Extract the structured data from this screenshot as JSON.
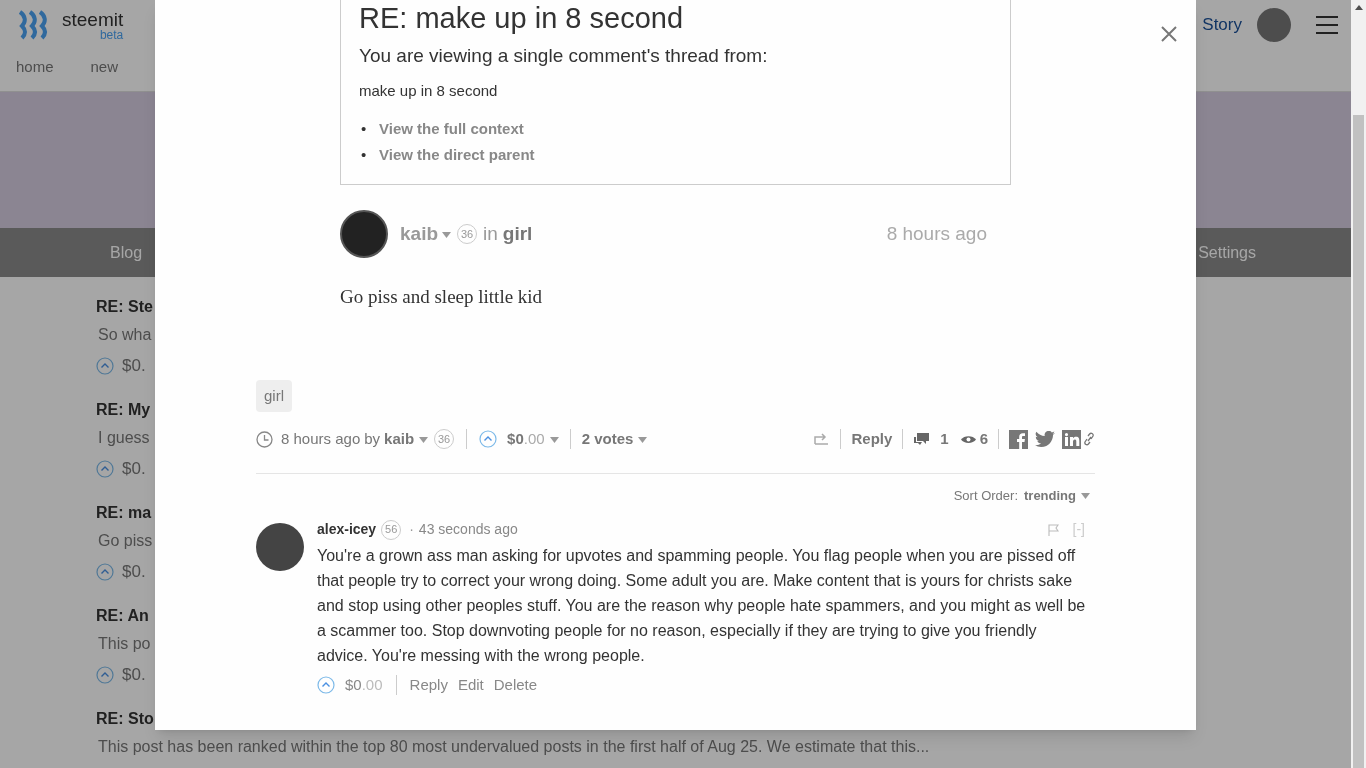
{
  "background": {
    "logo": {
      "name": "steemit",
      "tag": "beta"
    },
    "nav": [
      "home",
      "new"
    ],
    "header_link": "Story",
    "tabs": [
      "Blog",
      "Settings"
    ],
    "posts": [
      {
        "title": "RE: Ste",
        "excerpt": "So wha",
        "payout": "$0."
      },
      {
        "title": "RE: My",
        "excerpt": "I guess",
        "payout": "$0."
      },
      {
        "title": "RE: ma",
        "excerpt": "Go piss",
        "payout": "$0."
      },
      {
        "title": "RE: An",
        "excerpt": "This po",
        "payout": "$0."
      },
      {
        "title": "RE: Sto",
        "excerpt": "This post has been ranked within the top 80 most undervalued posts in the first half of Aug 25. We estimate that this..."
      }
    ]
  },
  "modal": {
    "context": {
      "title": "RE: make up in 8 second",
      "intro": "You are viewing a single comment's thread from:",
      "parent_title": "make up in 8 second",
      "bullet": "•",
      "links": [
        "View the full context",
        "View the direct parent"
      ]
    },
    "post": {
      "author": "kaib",
      "reputation": "36",
      "in": "in",
      "category": "girl",
      "time": "8 hours ago",
      "body": "Go piss and sleep little kid",
      "tags": [
        "girl"
      ],
      "footer": {
        "time": "8 hours ago",
        "by": "by",
        "author": "kaib",
        "reputation": "36",
        "payout": "$0",
        "payout_cents": ".00",
        "votes": "2 votes",
        "reply": "Reply",
        "comments": "1",
        "views": "6"
      }
    },
    "sort": {
      "label": "Sort Order:",
      "value": "trending"
    },
    "comments": [
      {
        "author": "alex-icey",
        "reputation": "56",
        "dot": "·",
        "time": "43 seconds ago",
        "collapse": "[-]",
        "body": "You're a grown ass man asking for upvotes and spamming people. You flag people when you are pissed off that people try to correct your wrong doing. Some adult you are. Make content that is yours for christs sake and stop using other peoples stuff. You are the reason why people hate spammers, and you might as well be a scammer too. Stop downvoting people for no reason, especially if they are trying to give you friendly advice. You're messing with the wrong people.",
        "payout": "$0",
        "payout_cents": ".00",
        "actions": [
          "Reply",
          "Edit",
          "Delete"
        ]
      }
    ]
  }
}
